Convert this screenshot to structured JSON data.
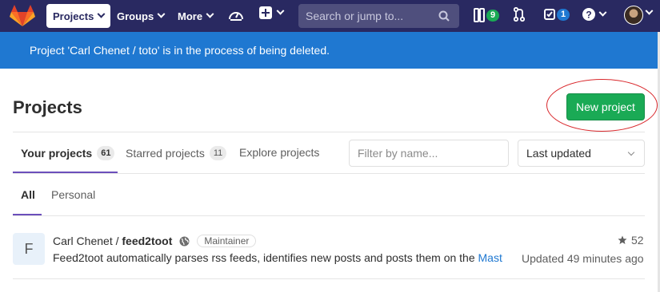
{
  "navbar": {
    "projects_label": "Projects",
    "groups_label": "Groups",
    "more_label": "More",
    "search_placeholder": "Search or jump to...",
    "todos_count": "9",
    "issues_count": "1",
    "colors": {
      "bg": "#292961",
      "todos_badge": "#1aaa55",
      "issues_badge": "#1f78d1"
    }
  },
  "flash": {
    "message": "Project 'Carl Chenet / toto' is in the process of being deleted."
  },
  "header": {
    "title": "Projects",
    "new_project_label": "New project"
  },
  "tabs": [
    {
      "label": "Your projects",
      "count": "61",
      "active": true
    },
    {
      "label": "Starred projects",
      "count": "11",
      "active": false
    },
    {
      "label": "Explore projects",
      "count": "",
      "active": false
    }
  ],
  "filter": {
    "placeholder": "Filter by name..."
  },
  "sort": {
    "selected": "Last updated"
  },
  "subtabs": [
    {
      "label": "All",
      "active": true
    },
    {
      "label": "Personal",
      "active": false
    }
  ],
  "projects": [
    {
      "avatar_letter": "F",
      "namespace": "Carl Chenet / ",
      "name": "feed2toot",
      "visibility_icon": "globe-icon",
      "role": "Maintainer",
      "description": "Feed2toot automatically parses rss feeds, identifies new posts and posts them on the ",
      "description_link": "Mast",
      "stars": "52",
      "updated": "Updated 49 minutes ago"
    }
  ]
}
